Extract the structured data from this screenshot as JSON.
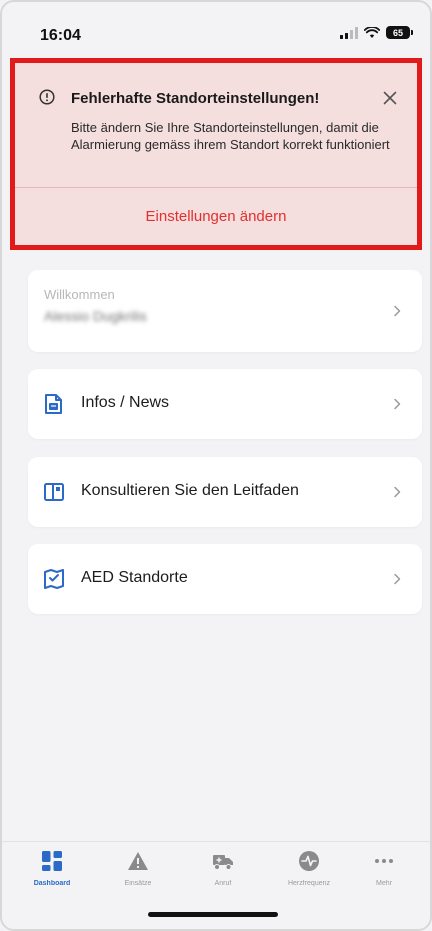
{
  "status_bar": {
    "time": "16:04",
    "battery": "65"
  },
  "alert": {
    "title": "Fehlerhafte Standorteinstellungen!",
    "message": "Bitte ändern Sie Ihre Standorteinstellungen, damit die Alarmierung gemäss ihrem Standort korrekt funktioniert",
    "action_label": "Einstellungen ändern",
    "border_color": "#e21a1a",
    "background_color": "#f5dede",
    "action_color": "#e0312f"
  },
  "welcome": {
    "label": "Willkommen",
    "name": "Alessio Dugkrilis"
  },
  "menu": [
    {
      "label": "Infos / News",
      "icon": "news-icon"
    },
    {
      "label": "Konsultieren Sie den Leitfaden",
      "icon": "guide-icon"
    },
    {
      "label": "AED Standorte",
      "icon": "map-icon"
    }
  ],
  "tabs": [
    {
      "label": "Dashboard",
      "icon": "dashboard-icon",
      "active": true
    },
    {
      "label": "Einsätze",
      "icon": "warning-icon",
      "active": false
    },
    {
      "label": "Anruf",
      "icon": "truck-icon",
      "active": false
    },
    {
      "label": "Herzfrequenz",
      "icon": "heartrate-icon",
      "active": false
    },
    {
      "label": "Mehr",
      "icon": "more-icon",
      "active": false
    }
  ],
  "colors": {
    "accent": "#2b6ac7",
    "background": "#f3f3f5"
  }
}
